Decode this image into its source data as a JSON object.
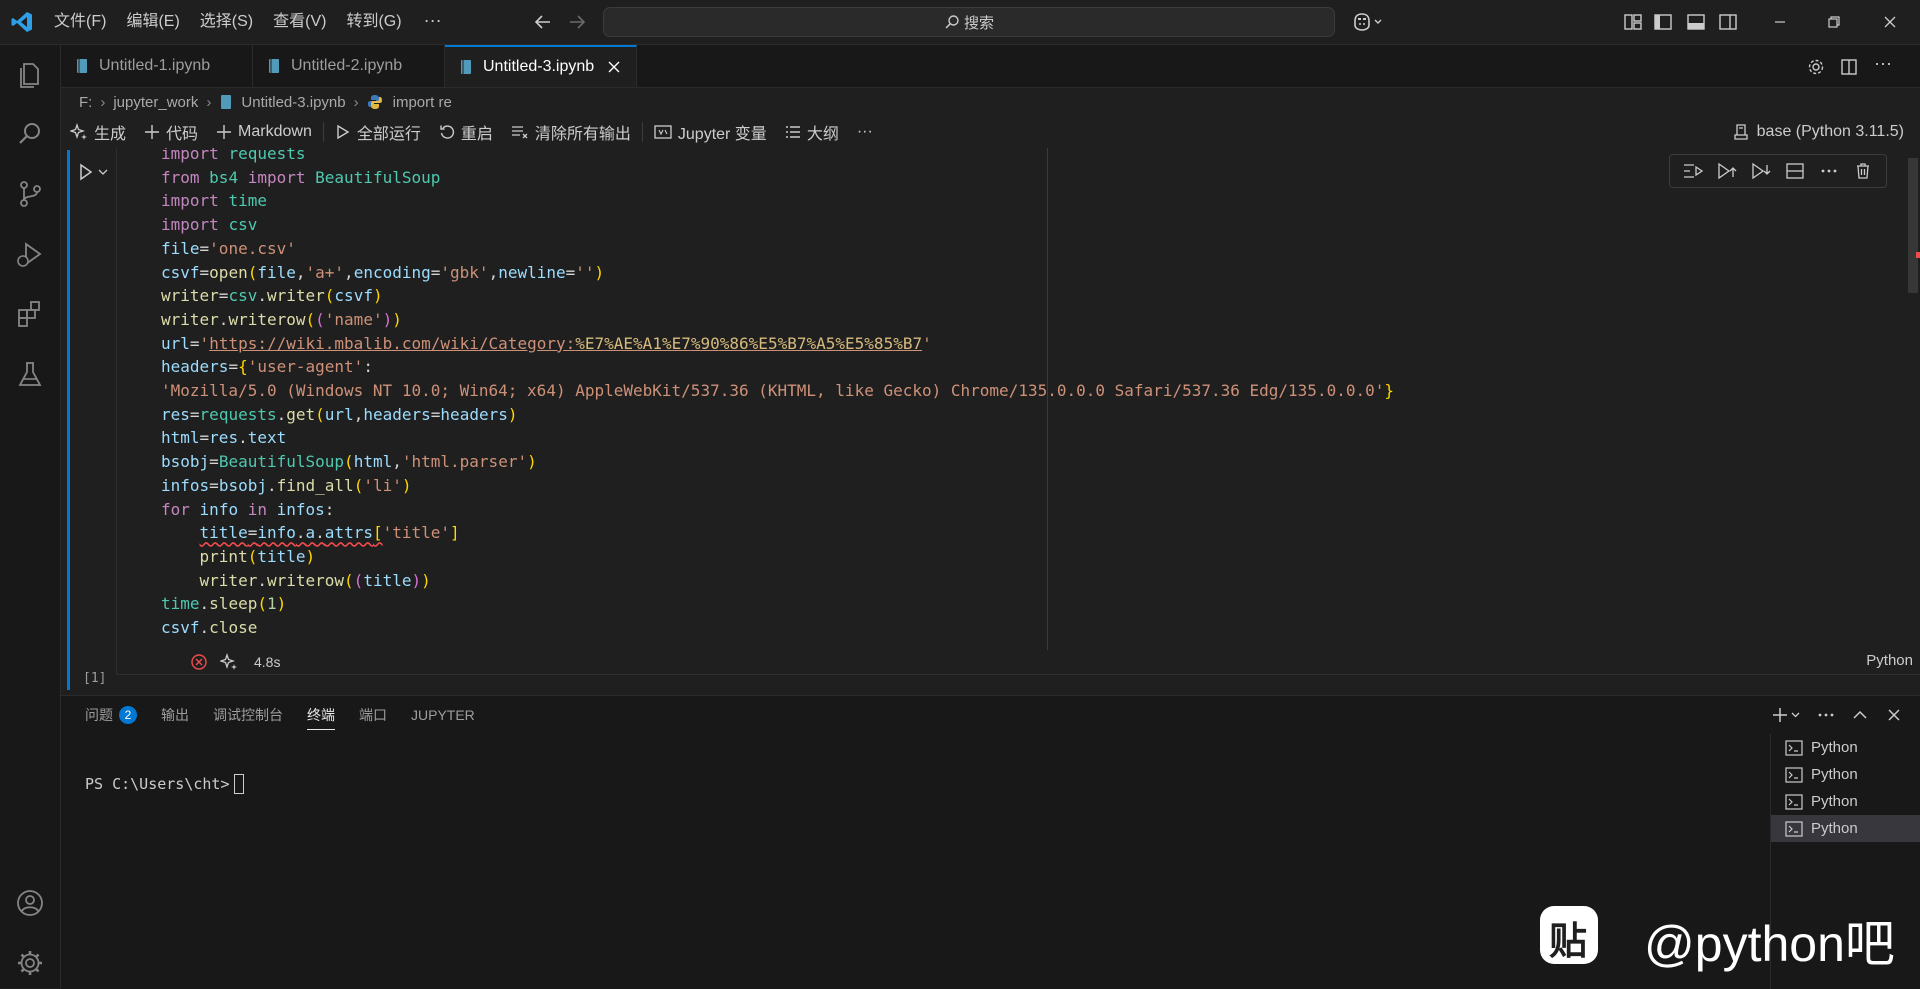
{
  "menus": [
    "文件(F)",
    "编辑(E)",
    "选择(S)",
    "查看(V)",
    "转到(G)"
  ],
  "menu_more": "···",
  "search": {
    "label": "搜索"
  },
  "tabs": [
    {
      "label": "Untitled-1.ipynb"
    },
    {
      "label": "Untitled-2.ipynb"
    },
    {
      "label": "Untitled-3.ipynb"
    }
  ],
  "breadcrumb": {
    "drive": "F:",
    "folder": "jupyter_work",
    "file": "Untitled-3.ipynb",
    "symbol": "import re"
  },
  "toolbar": {
    "generate": "生成",
    "code": "代码",
    "markdown": "Markdown",
    "run_all": "全部运行",
    "restart": "重启",
    "clear_outputs": "清除所有输出",
    "variables": "Jupyter 变量",
    "outline": "大纲",
    "more": "···",
    "kernel": "base (Python 3.11.5)"
  },
  "cell": {
    "exec_count": "[1]",
    "duration": "4.8s",
    "language": "Python",
    "code_lines": [
      "import requests",
      "from bs4 import BeautifulSoup",
      "import time",
      "import csv",
      "file='one.csv'",
      "csvf=open(file,'a+',encoding='gbk',newline='')",
      "writer=csv.writer(csvf)",
      "writer.writerow(('name'))",
      "url='https://wiki.mbalib.com/wiki/Category:%E7%AE%A1%E7%90%86%E5%B7%A5%E5%85%B7'",
      "headers={'user-agent':",
      "'Mozilla/5.0 (Windows NT 10.0; Win64; x64) AppleWebKit/537.36 (KHTML, like Gecko) Chrome/135.0.0.0 Safari/537.36 Edg/135.0.0.0'}",
      "res=requests.get(url,headers=headers)",
      "html=res.text",
      "bsobj=BeautifulSoup(html,'html.parser')",
      "infos=bsobj.find_all('li')",
      "for info in infos:",
      "    title=info.a.attrs['title']",
      "    print(title)",
      "    writer.writerow((title))",
      "time.sleep(1)",
      "csvf.close"
    ]
  },
  "panel": {
    "tabs": [
      "问题",
      "输出",
      "调试控制台",
      "终端",
      "端口",
      "JUPYTER"
    ],
    "problems_count": "2",
    "active_tab": "终端",
    "prompt": "PS C:\\Users\\cht>",
    "terminals": [
      "Python",
      "Python",
      "Python",
      "Python"
    ]
  },
  "watermark": {
    "text": "@python吧",
    "glyph": "贴"
  },
  "colors": {
    "accent": "#0078d4",
    "background": "#1f1f1f",
    "error": "#f14c4c"
  }
}
